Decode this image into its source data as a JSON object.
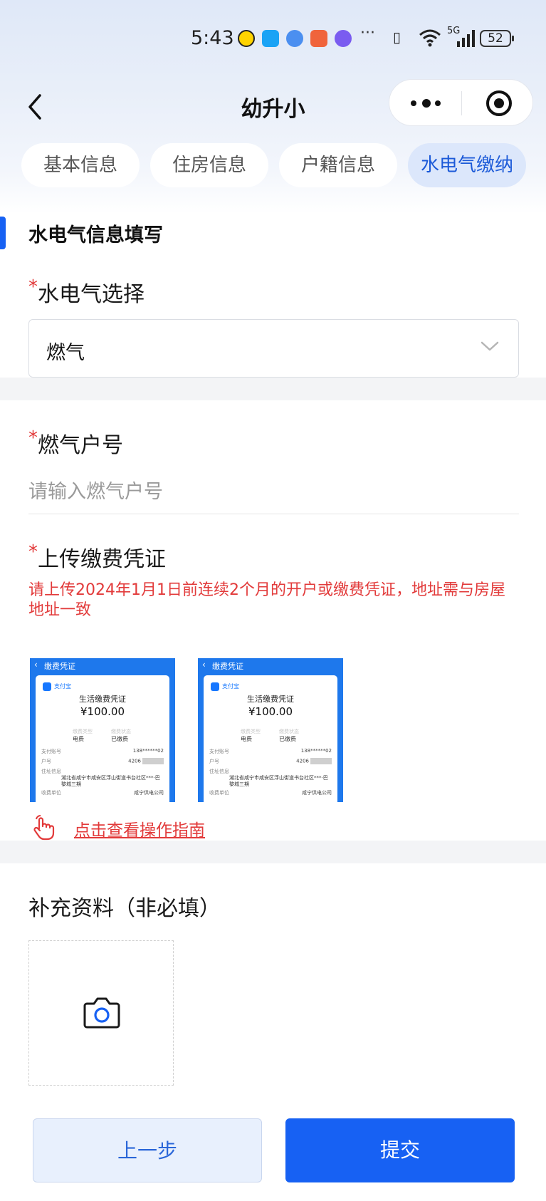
{
  "status_bar": {
    "time": "5:43",
    "more": "···",
    "network": "5G",
    "battery": "52"
  },
  "nav": {
    "title": "幼升小"
  },
  "tabs": [
    {
      "label": "基本信息",
      "active": false
    },
    {
      "label": "住房信息",
      "active": false
    },
    {
      "label": "户籍信息",
      "active": false
    },
    {
      "label": "水电气缴纳",
      "active": true
    }
  ],
  "section": {
    "title": "水电气信息填写"
  },
  "utility_select": {
    "required_mark": "*",
    "label": "水电气选择",
    "value": "燃气"
  },
  "account": {
    "required_mark": "*",
    "label": "燃气户号",
    "placeholder": "请输入燃气户号",
    "value": ""
  },
  "upload": {
    "required_mark": "*",
    "label": "上传缴费凭证",
    "hint": "请上传2024年1月1日前连续2个月的开户或缴费凭证，地址需与房屋地址一致",
    "examples": [
      {
        "bar_title": "缴费凭证",
        "app": "支付宝",
        "title": "生活缴费凭证",
        "amount": "¥100.00",
        "type_key": "缴费类型",
        "type_val": "电费",
        "status_key": "缴费状态",
        "status_val": "已缴费",
        "pay_account_key": "支付账号",
        "pay_account_val": "138******02",
        "household_key": "户号",
        "household_val": "4206",
        "address_key": "住址信息",
        "address_val": "湖北省咸宁市咸安区浮山街道书台社区***·巴黎城三期",
        "unit_key": "收费单位",
        "unit_val": "咸宁供电公司"
      },
      {
        "bar_title": "缴费凭证",
        "app": "支付宝",
        "title": "生活缴费凭证",
        "amount": "¥100.00",
        "type_key": "缴费类型",
        "type_val": "电费",
        "status_key": "缴费状态",
        "status_val": "已缴费",
        "pay_account_key": "支付账号",
        "pay_account_val": "138******02",
        "household_key": "户号",
        "household_val": "4206",
        "address_key": "住址信息",
        "address_val": "湖北省咸宁市咸安区浮山街道书台社区***·巴黎城三期",
        "unit_key": "收费单位",
        "unit_val": "咸宁供电公司"
      }
    ],
    "guide_link": "点击查看操作指南"
  },
  "supplement": {
    "title": "补充资料（非必填）"
  },
  "buttons": {
    "prev": "上一步",
    "submit": "提交"
  },
  "colors": {
    "primary": "#1761f3",
    "required_red": "#e23a3a",
    "tab_active_bg": "#dce7fb"
  }
}
